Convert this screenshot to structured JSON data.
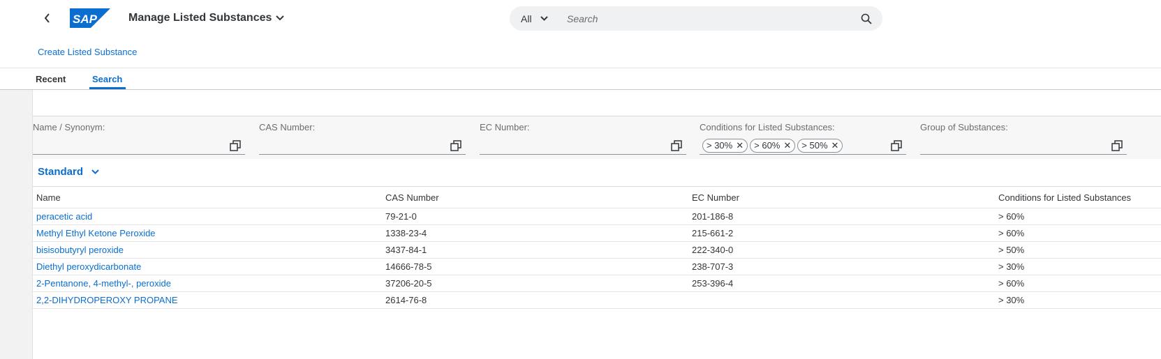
{
  "shell": {
    "logo_text": "SAP",
    "app_title": "Manage Listed Substances",
    "search_scope": "All",
    "search_placeholder": "Search"
  },
  "actions": {
    "create_label": "Create Listed Substance"
  },
  "tabs": [
    {
      "label": "Recent",
      "selected": false
    },
    {
      "label": "Search",
      "selected": true
    }
  ],
  "filters": {
    "name_label": "Name / Synonym:",
    "cas_label": "CAS Number:",
    "ec_label": "EC Number:",
    "conditions_label": "Conditions for Listed Substances:",
    "conditions_tokens": [
      "> 30%",
      "> 60%",
      "> 50%"
    ],
    "group_label": "Group of Substances:"
  },
  "variant": {
    "label": "Standard"
  },
  "table": {
    "columns": [
      "Name",
      "CAS Number",
      "EC Number",
      "Conditions for Listed Substances"
    ],
    "rows": [
      {
        "name": "peracetic acid",
        "cas": "79-21-0",
        "ec": "201-186-8",
        "condition": "> 60%"
      },
      {
        "name": "Methyl Ethyl Ketone Peroxide",
        "cas": "1338-23-4",
        "ec": "215-661-2",
        "condition": "> 60%"
      },
      {
        "name": "bisisobutyryl peroxide",
        "cas": "3437-84-1",
        "ec": "222-340-0",
        "condition": "> 50%"
      },
      {
        "name": "Diethyl peroxydicarbonate",
        "cas": "14666-78-5",
        "ec": "238-707-3",
        "condition": "> 30%"
      },
      {
        "name": "2-Pentanone, 4-methyl-, peroxide",
        "cas": "37206-20-5",
        "ec": "253-396-4",
        "condition": "> 60%"
      },
      {
        "name": "2,2-DIHYDROPEROXY PROPANE",
        "cas": "2614-76-8",
        "ec": "",
        "condition": "> 30%"
      }
    ]
  },
  "colors": {
    "brand": "#0a6ed1",
    "text": "#32363a",
    "logo_blue": "#0a6ed1"
  }
}
